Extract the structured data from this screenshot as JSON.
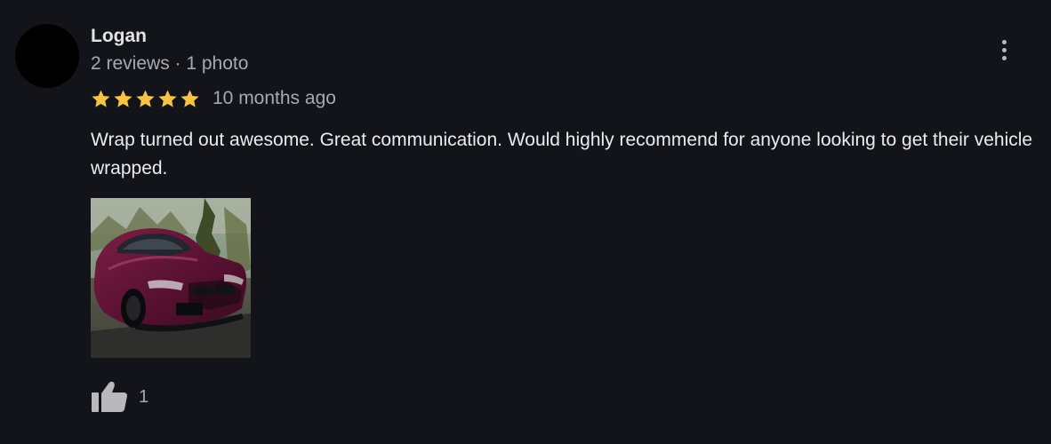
{
  "review": {
    "author": {
      "name": "Logan",
      "meta": "2 reviews · 1 photo"
    },
    "rating": 5,
    "rating_max": 5,
    "date": "10 months ago",
    "text": "Wrap turned out awesome. Great communication. Would highly recommend for anyone looking to get their vehicle wrapped.",
    "photo": {
      "icon": "car-photo"
    },
    "helpful": {
      "icon": "thumbs-up-icon",
      "count": "1"
    },
    "menu": {
      "icon": "more-vert-icon"
    }
  },
  "colors": {
    "background": "#13131a",
    "star": "#f6c342",
    "primary_text": "#ececee",
    "secondary_text": "#a9a9ad"
  }
}
